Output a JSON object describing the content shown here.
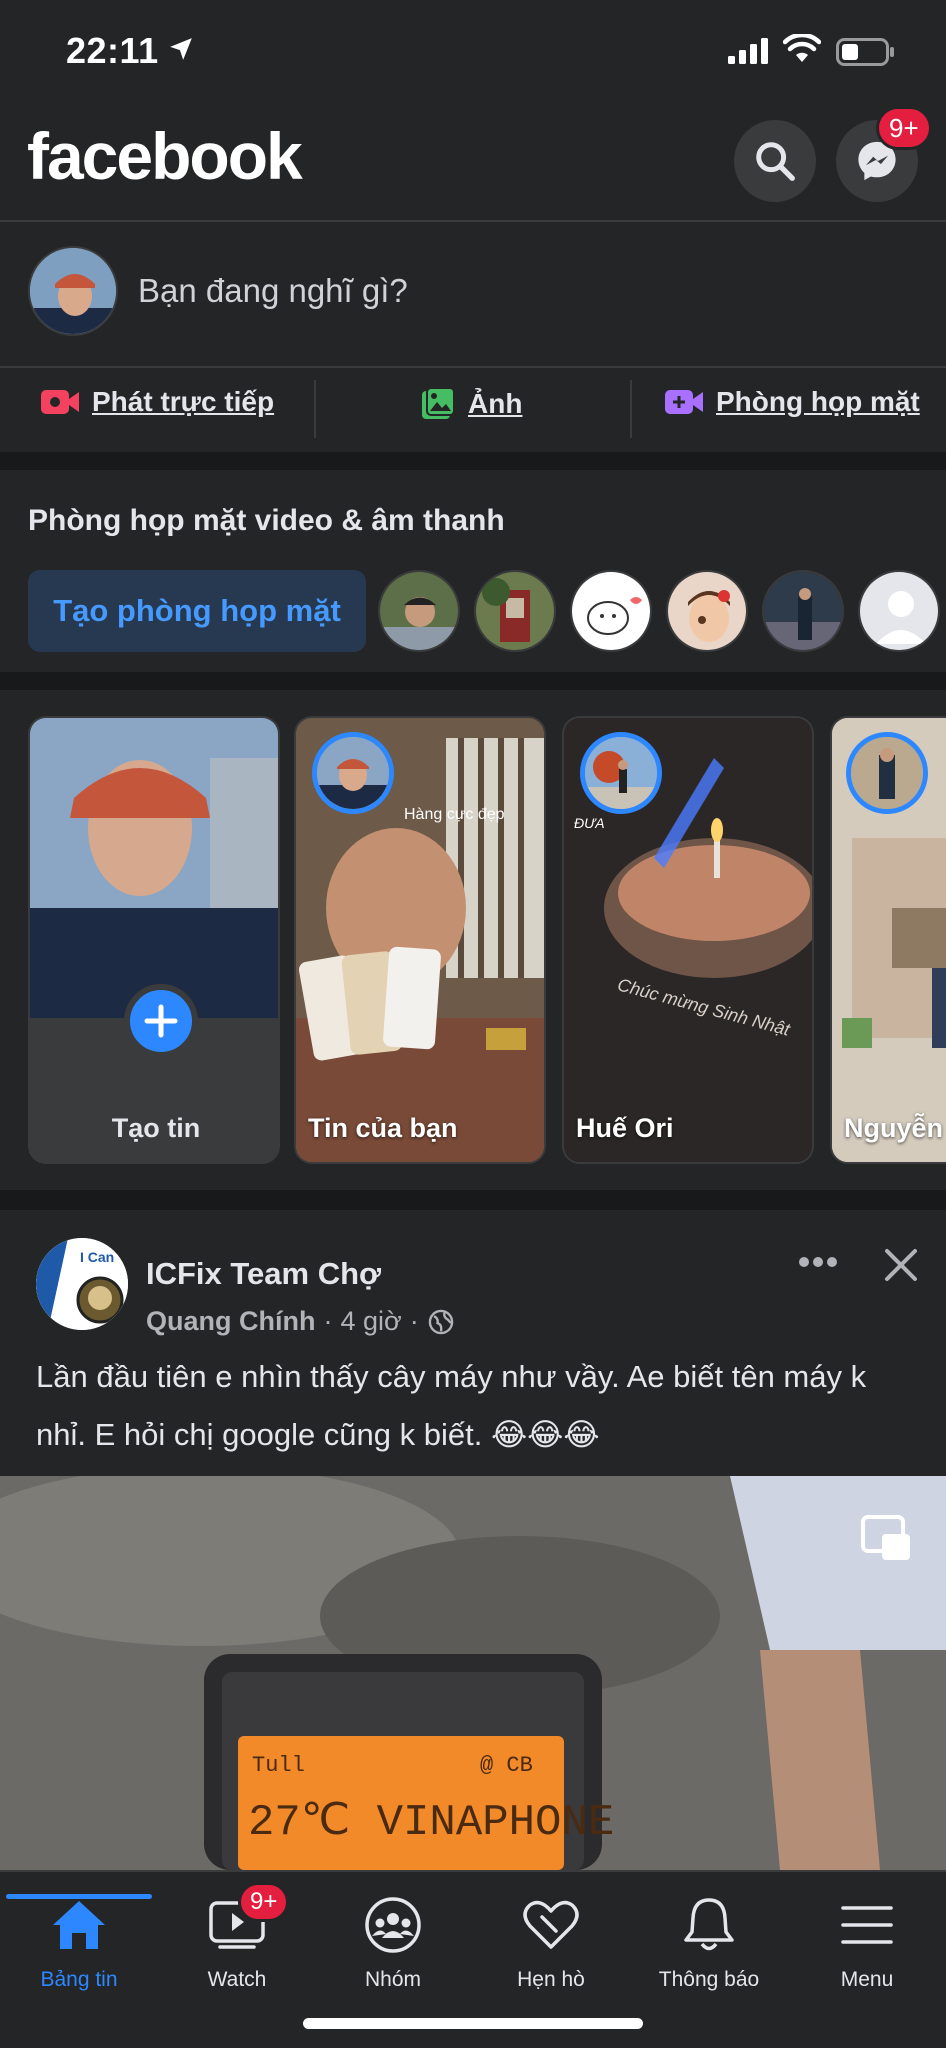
{
  "status_bar": {
    "time": "22:11"
  },
  "header": {
    "logo": "facebook",
    "messenger_badge": "9+"
  },
  "composer": {
    "placeholder": "Bạn đang nghĩ gì?"
  },
  "actions": [
    {
      "label": "Phát trực tiếp",
      "icon": "live-video-icon",
      "color": "#f3425f"
    },
    {
      "label": "Ảnh",
      "icon": "photo-icon",
      "color": "#45bd62"
    },
    {
      "label": "Phòng họp mặt",
      "icon": "room-camera-icon",
      "color": "#a970ff"
    }
  ],
  "rooms": {
    "title": "Phòng họp mặt video & âm thanh",
    "create_label": "Tạo phòng họp mặt"
  },
  "stories": [
    {
      "name": "Tạo tin",
      "type": "create"
    },
    {
      "name": "Tin của bạn",
      "caption": "Hàng cực đẹp"
    },
    {
      "name": "Huế Ori",
      "caption": "ĐƯA"
    },
    {
      "name": "Nguyễn V"
    }
  ],
  "post": {
    "page_name": "ICFix Team Chợ",
    "author": "Quang Chính",
    "time": "4 giờ",
    "separator": "·",
    "text": "Lần đầu tiên e nhìn thấy cây máy như vầy. Ae biết tên máy k nhỉ. E hỏi chị google cũng k biết. 😂😂😂",
    "avatar_text": "I Can",
    "image_lcd_line1": "27℃   VINAPHONE"
  },
  "bottom_nav": [
    {
      "label": "Bảng tin",
      "icon": "home-icon",
      "active": true
    },
    {
      "label": "Watch",
      "icon": "watch-icon",
      "badge": "9+"
    },
    {
      "label": "Nhóm",
      "icon": "groups-icon"
    },
    {
      "label": "Hẹn hò",
      "icon": "dating-heart-icon"
    },
    {
      "label": "Thông báo",
      "icon": "bell-icon"
    },
    {
      "label": "Menu",
      "icon": "menu-icon"
    }
  ],
  "colors": {
    "accent": "#2d88ff",
    "badge": "#e41e3f",
    "background": "#242526"
  }
}
